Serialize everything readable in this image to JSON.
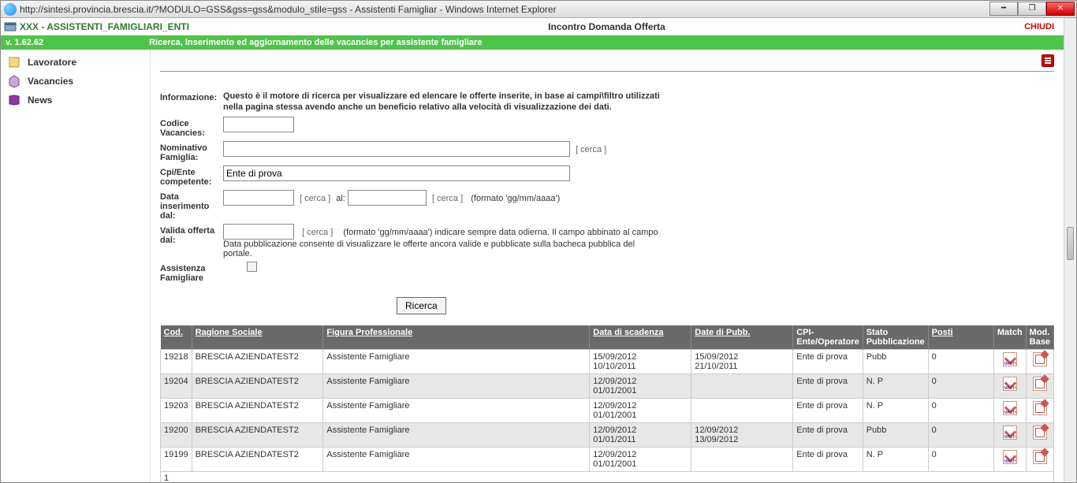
{
  "browser": {
    "url": "http://sintesi.provincia.brescia.it/?MODULO=GSS&gss=gss&modulo_stile=gss - Assistenti Famigliar - Windows Internet Explorer"
  },
  "header": {
    "breadcrumb": "XXX - ASSISTENTI_FAMIGLIARI_ENTI",
    "center_title": "Incontro Domanda Offerta",
    "close": "CHIUDI",
    "version": "v. 1.62.62",
    "page_subtitle": "Ricerca, Inserimento ed aggiornamento delle vacancies per assistente famigliare"
  },
  "sidebar": {
    "items": [
      {
        "label": "Lavoratore"
      },
      {
        "label": "Vacancies"
      },
      {
        "label": "News"
      }
    ]
  },
  "filters": {
    "informazione_label": "Informazione:",
    "informazione_text": "Questo è il motore di ricerca per visualizzare ed elencare le offerte inserite, in base ai campi\\filtro utilizzati nella pagina stessa avendo anche un beneficio relativo alla velocità di visualizzazione dei dati.",
    "codice_label": "Codice Vacancies:",
    "codice_value": "",
    "nominativo_label": "Nominativo Famiglia:",
    "nominativo_value": "",
    "cerca_text": "[ cerca ]",
    "cpi_label": "Cpi/Ente competente:",
    "cpi_value": "Ente di prova",
    "data_ins_label": "Data inserimento dal:",
    "data_ins_from": "",
    "al_label": "al:",
    "data_ins_to": "",
    "formato_hint": "(formato 'gg/mm/aaaa')",
    "valida_label": "Valida offerta dal:",
    "valida_value": "",
    "valida_hint": "(formato 'gg/mm/aaaa') indicare sempre data odierna. Il campo abbinato al campo Data pubblicazione consente di visualizzare le offerte ancora valide e pubblicate sulla bacheca pubblica del portale.",
    "assistenza_label": "Assistenza Famigliare",
    "ricerca_btn": "Ricerca"
  },
  "columns": {
    "cod": "Cod.",
    "ragione": "Ragione Sociale",
    "figura": "Figura Professionale",
    "scadenza": "Data di scadenza",
    "pubb": "Date di Pubb.",
    "cpi": "CPI-Ente/Operatore",
    "stato": "Stato Pubblicazione",
    "posti": "Posti",
    "match": "Match",
    "mod": "Mod. Base"
  },
  "rows": [
    {
      "cod": "19218",
      "ragione": "BRESCIA AZIENDATEST2",
      "figura": "Assistente Famigliare",
      "scad1": "15/09/2012",
      "scad2": "10/10/2011",
      "pubb1": "15/09/2012",
      "pubb2": "21/10/2011",
      "cpi": "Ente di prova",
      "stato": "Pubb",
      "posti": "0"
    },
    {
      "cod": "19204",
      "ragione": "BRESCIA AZIENDATEST2",
      "figura": "Assistente Famigliare",
      "scad1": "12/09/2012",
      "scad2": "01/01/2001",
      "pubb1": "",
      "pubb2": "",
      "cpi": "Ente di prova",
      "stato": "N. P",
      "posti": "0"
    },
    {
      "cod": "19203",
      "ragione": "BRESCIA AZIENDATEST2",
      "figura": "Assistente Famigliare",
      "scad1": "12/09/2012",
      "scad2": "01/01/2001",
      "pubb1": "",
      "pubb2": "",
      "cpi": "Ente di prova",
      "stato": "N. P",
      "posti": "0"
    },
    {
      "cod": "19200",
      "ragione": "BRESCIA AZIENDATEST2",
      "figura": "Assistente Famigliare",
      "scad1": "12/09/2012",
      "scad2": "01/01/2011",
      "pubb1": "12/09/2012",
      "pubb2": "13/09/2012",
      "cpi": "Ente di prova",
      "stato": "Pubb",
      "posti": "0"
    },
    {
      "cod": "19199",
      "ragione": "BRESCIA AZIENDATEST2",
      "figura": "Assistente Famigliare",
      "scad1": "12/09/2012",
      "scad2": "01/01/2001",
      "pubb1": "",
      "pubb2": "",
      "cpi": "Ente di prova",
      "stato": "N. P",
      "posti": "0"
    }
  ],
  "pager": {
    "current": "1"
  }
}
